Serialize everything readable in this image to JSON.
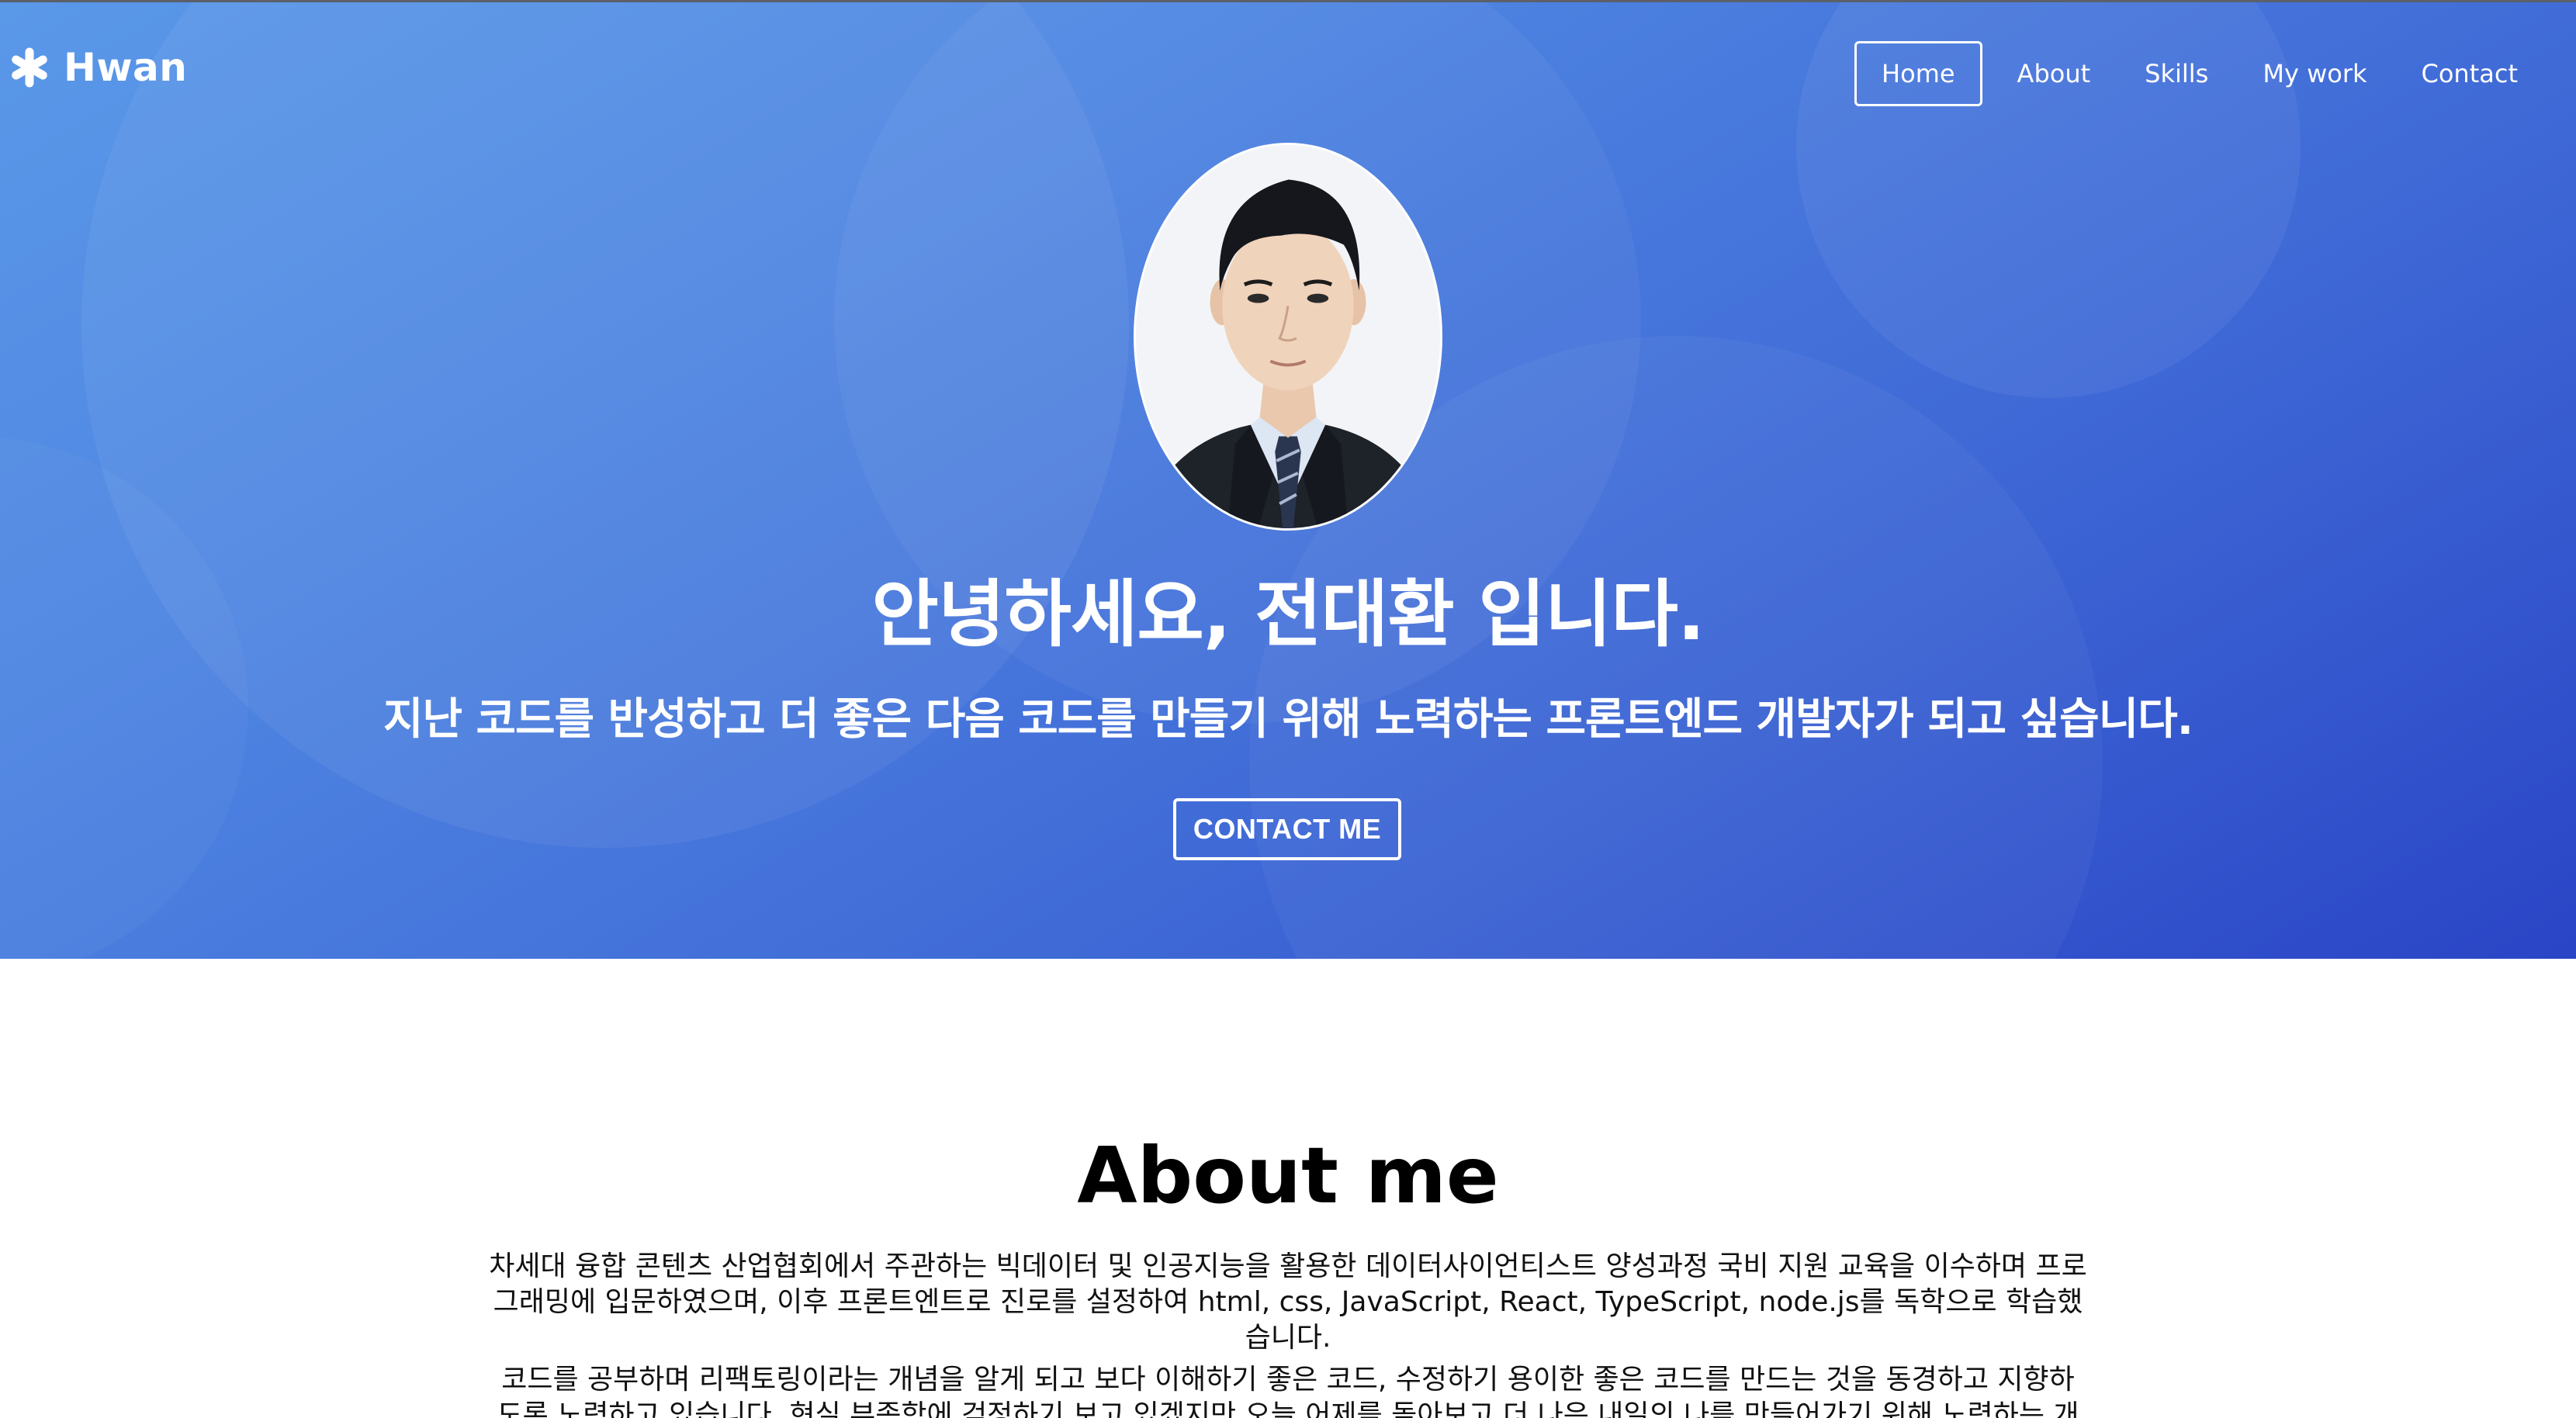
{
  "navbar": {
    "logo_text": "Hwan",
    "logo_icon": "asterisk-icon",
    "items": [
      {
        "label": "Home",
        "active": true
      },
      {
        "label": "About",
        "active": false
      },
      {
        "label": "Skills",
        "active": false
      },
      {
        "label": "My work",
        "active": false
      },
      {
        "label": "Contact",
        "active": false
      }
    ]
  },
  "hero": {
    "title": "안녕하세요, 전대환 입니다.",
    "subtitle": "지난 코드를 반성하고 더 좋은 다음 코드를 만들기 위해 노력하는 프론트엔드 개발자가 되고 싶습니다.",
    "contact_button": "CONTACT ME",
    "avatar": "profile-photo",
    "gradient_start": "#5a98e8",
    "gradient_end": "#2a45c6"
  },
  "about": {
    "title": "About me",
    "paragraphs": [
      "차세대 융합 콘텐츠 산업협회에서 주관하는 빅데이터 및 인공지능을 활용한 데이터사이언티스트 양성과정 국비 지원 교육을 이수하며 프로그래밍에 입문하였으며, 이후 프론트엔트로 진로를 설정하여 html, css, JavaScript, React, TypeScript, node.js를 독학으로 학습했습니다.",
      "코드를 공부하며 리팩토링이라는 개념을 알게 되고 보다 이해하기 좋은 코드, 수정하기 용이한 좋은 코드를 만드는 것을 동경하고 지향하도록 노력하고 있습니다. 현실 부족함에 걱정하기 보고 있겠지만 오늘 어제를 돌아보고 더 나은 내일의 나를 만들어가기 위해 노력하는 개"
    ]
  }
}
